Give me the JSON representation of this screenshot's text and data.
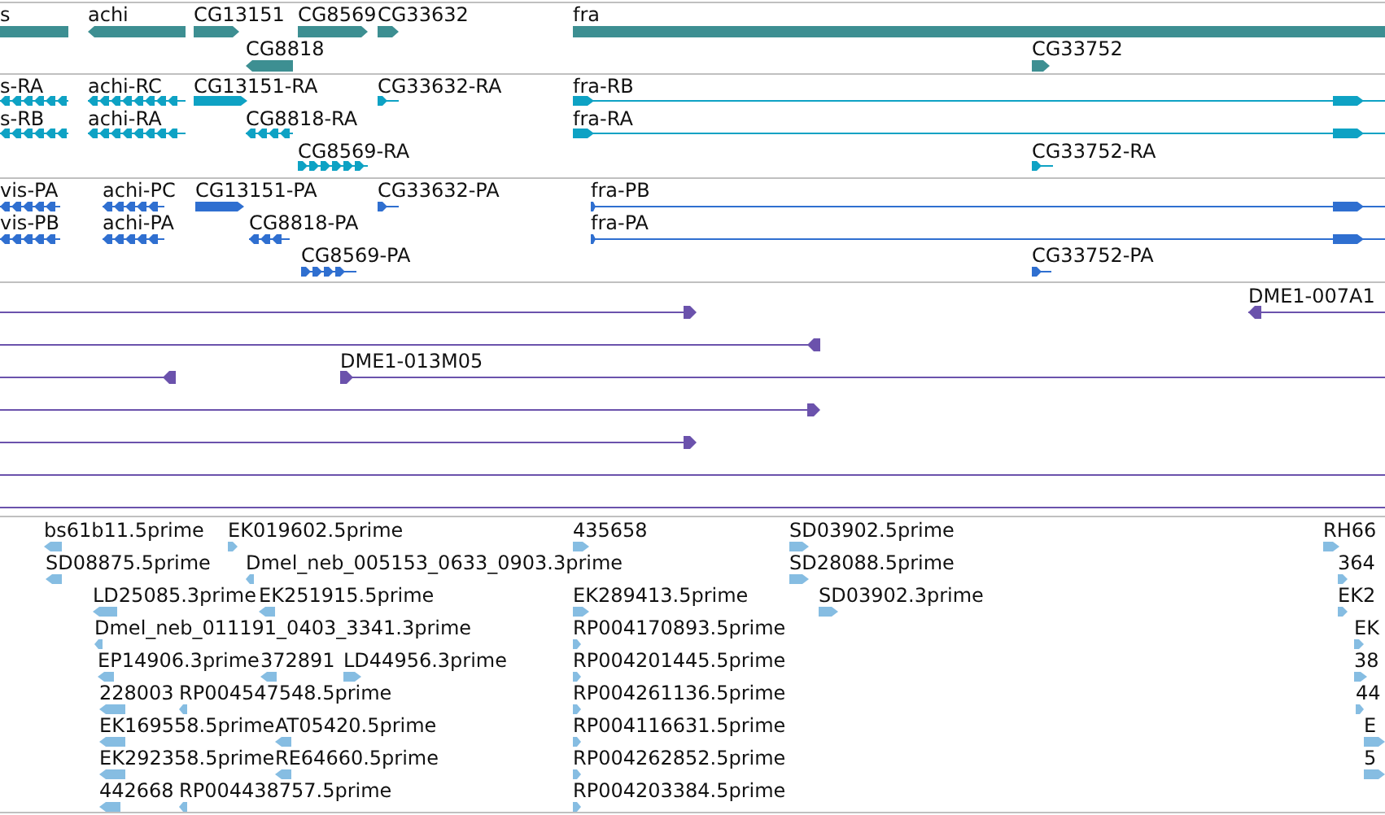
{
  "tracks": [
    {
      "kind": "gene",
      "features": [
        {
          "label": "s"
        },
        {
          "label": "achi",
          "reverse": true
        },
        {
          "label": "CG13151",
          "reverse": false
        },
        {
          "label": "CG8569",
          "reverse": false
        },
        {
          "label": "CG33632",
          "reverse": false
        },
        {
          "label": "fra"
        },
        {
          "label": "CG8818",
          "reverse": true
        },
        {
          "label": "CG33752",
          "reverse": false
        }
      ]
    },
    {
      "kind": "transcript",
      "features": [
        {
          "label": "s-RA",
          "reverse": true
        },
        {
          "label": "achi-RC",
          "reverse": true
        },
        {
          "label": "CG13151-RA",
          "reverse": false
        },
        {
          "label": "CG33632-RA",
          "reverse": false
        },
        {
          "label": "fra-RB",
          "reverse": false
        },
        {
          "label": "s-RB",
          "reverse": true
        },
        {
          "label": "achi-RA",
          "reverse": true
        },
        {
          "label": "CG8818-RA",
          "reverse": true
        },
        {
          "label": "fra-RA",
          "reverse": false
        },
        {
          "label": "CG8569-RA",
          "reverse": false
        },
        {
          "label": "CG33752-RA",
          "reverse": false
        }
      ]
    },
    {
      "kind": "protein",
      "features": [
        {
          "label": "vis-PA",
          "reverse": true
        },
        {
          "label": "achi-PC",
          "reverse": true
        },
        {
          "label": "CG13151-PA",
          "reverse": false
        },
        {
          "label": "CG33632-PA",
          "reverse": false
        },
        {
          "label": "fra-PB",
          "reverse": false
        },
        {
          "label": "vis-PB",
          "reverse": true
        },
        {
          "label": "achi-PA",
          "reverse": true
        },
        {
          "label": "CG8818-PA",
          "reverse": true
        },
        {
          "label": "fra-PA",
          "reverse": false
        },
        {
          "label": "CG8569-PA",
          "reverse": false
        },
        {
          "label": "CG33752-PA",
          "reverse": false
        }
      ]
    },
    {
      "kind": "clone",
      "features": [
        {
          "kind": "arrow",
          "reverse": false
        },
        {
          "kind": "arrow",
          "label": "DME1-007A1",
          "reverse": true
        },
        {
          "kind": "arrow",
          "reverse": true
        },
        {
          "kind": "arrow",
          "reverse": true
        },
        {
          "kind": "arrow",
          "label": "DME1-013M05",
          "reverse": false
        },
        {
          "kind": "arrow",
          "reverse": false
        },
        {
          "kind": "arrow",
          "reverse": false
        },
        {
          "kind": "line"
        },
        {
          "kind": "line"
        }
      ]
    },
    {
      "kind": "est",
      "features": [
        {
          "label": "bs61b11.5prime",
          "reverse": true
        },
        {
          "label": "EK019602.5prime",
          "reverse": false
        },
        {
          "label": "435658",
          "reverse": false
        },
        {
          "label": "SD03902.5prime",
          "reverse": false
        },
        {
          "label": "RH66",
          "reverse": false
        },
        {
          "label": "SD08875.5prime",
          "reverse": true
        },
        {
          "label": "Dmel_neb_005153_0633_0903.3prime",
          "reverse": true
        },
        {
          "label": "SD28088.5prime",
          "reverse": false
        },
        {
          "label": "364",
          "reverse": false
        },
        {
          "label": "LD25085.3prime",
          "reverse": true
        },
        {
          "label": "EK251915.5prime",
          "reverse": true
        },
        {
          "label": "EK289413.5prime",
          "reverse": false
        },
        {
          "label": "SD03902.3prime",
          "reverse": false
        },
        {
          "label": "EK2",
          "reverse": false
        },
        {
          "label": "Dmel_neb_011191_0403_3341.3prime",
          "reverse": true
        },
        {
          "label": "RP004170893.5prime",
          "reverse": false
        },
        {
          "label": "EK",
          "reverse": false
        },
        {
          "label": "EP14906.3prime",
          "reverse": true
        },
        {
          "label": "372891",
          "reverse": true
        },
        {
          "label": "LD44956.3prime",
          "reverse": false
        },
        {
          "label": "RP004201445.5prime",
          "reverse": false
        },
        {
          "label": "38",
          "reverse": false
        },
        {
          "label": "228003",
          "reverse": true
        },
        {
          "label": "RP004547548.5prime",
          "reverse": true
        },
        {
          "label": "RP004261136.5prime",
          "reverse": false
        },
        {
          "label": "44",
          "reverse": false
        },
        {
          "label": "EK169558.5prime",
          "reverse": true
        },
        {
          "label": "AT05420.5prime",
          "reverse": true
        },
        {
          "label": "RP004116631.5prime",
          "reverse": false
        },
        {
          "label": "E",
          "reverse": false
        },
        {
          "label": "EK292358.5prime",
          "reverse": true
        },
        {
          "label": "RE64660.5prime",
          "reverse": true
        },
        {
          "label": "RP004262852.5prime",
          "reverse": false
        },
        {
          "label": "5",
          "reverse": false
        },
        {
          "label": "442668",
          "reverse": true
        },
        {
          "label": "RP004438757.5prime",
          "reverse": true
        },
        {
          "label": "RP004203384.5prime",
          "reverse": false
        }
      ]
    }
  ]
}
